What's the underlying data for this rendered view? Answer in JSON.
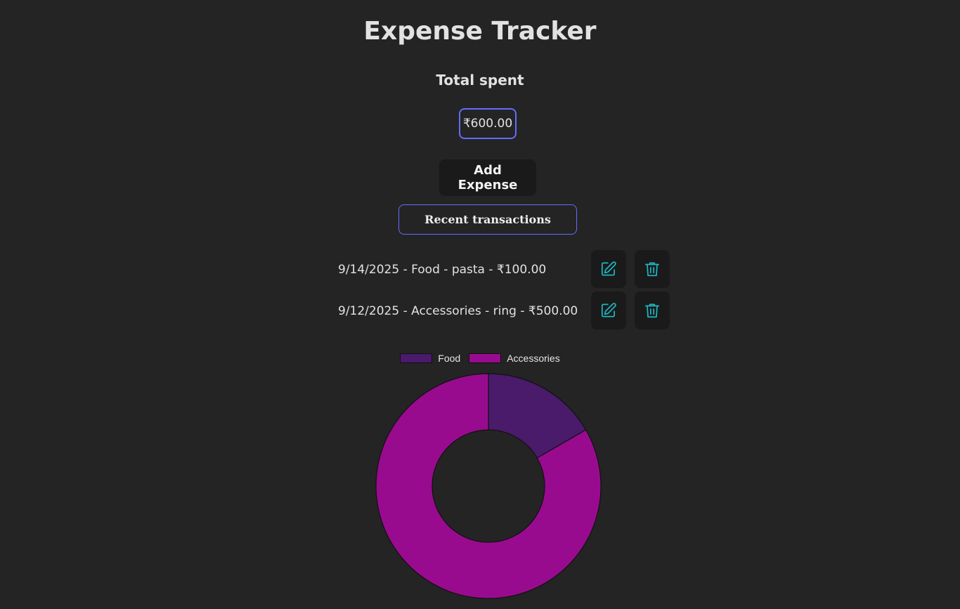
{
  "header": {
    "title": "Expense Tracker",
    "total_label": "Total spent",
    "total_value": "₹600.00"
  },
  "actions": {
    "add_expense_label": "Add Expense",
    "recent_transactions_label": "Recent transactions"
  },
  "transactions": [
    {
      "text": "9/14/2025 - Food - pasta - ₹100.00",
      "edit_icon": "edit-icon",
      "delete_icon": "trash-icon"
    },
    {
      "text": "9/12/2025 - Accessories - ring - ₹500.00",
      "edit_icon": "edit-icon",
      "delete_icon": "trash-icon"
    }
  ],
  "colors": {
    "background": "#242424",
    "accent_border": "#646cff",
    "button_bg": "#1a1a1a",
    "icon": "#1fb5c2",
    "food": "#4a1a6b",
    "accessories": "#990b8e"
  },
  "chart_data": {
    "type": "pie",
    "variant": "doughnut",
    "legend_position": "top",
    "categories": [
      "Food",
      "Accessories"
    ],
    "values": [
      100,
      500
    ],
    "colors": [
      "#4a1a6b",
      "#990b8e"
    ]
  }
}
